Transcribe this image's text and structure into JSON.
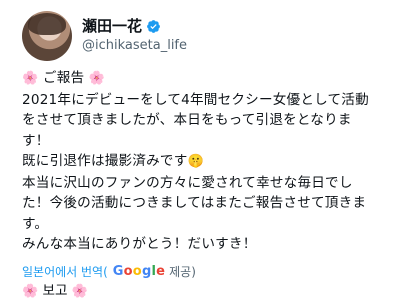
{
  "author": {
    "display_name": "瀬田一花",
    "handle": "@ichikaseta_life"
  },
  "post": {
    "flower": "🌸",
    "heading": "ご報告",
    "lines": [
      "2021年にデビューをして4年間セクシー女優として活動",
      "をさせて頂きましたが、本日をもって引退をとなりま",
      "す！",
      "既に引退作は撮影済みです",
      "本当に沢山のファンの方々に愛されて幸せな毎日でし",
      "た！今後の活動につきましてはまたご報告させて頂きま",
      "す。",
      "みんな本当にありがとう！だいすき！"
    ],
    "hush_emoji": "🤫"
  },
  "translation": {
    "link_text": "일본어에서 번역(",
    "google": "Google",
    "suffix": "제공)"
  },
  "translated_preview": "보고"
}
